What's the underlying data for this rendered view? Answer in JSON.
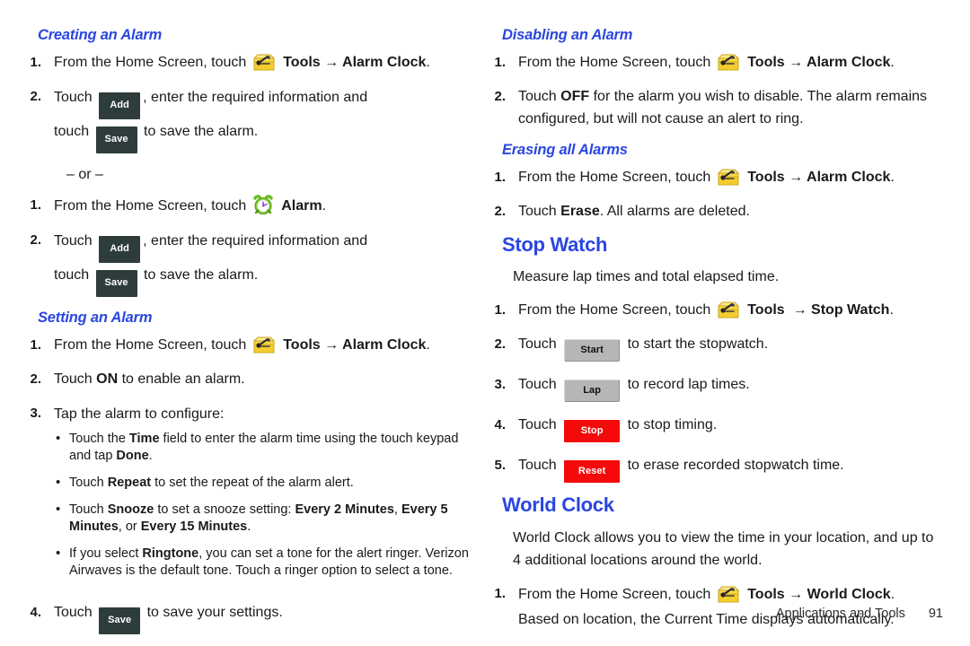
{
  "document": {
    "footer": {
      "section": "Applications and Tools",
      "page_number": "91"
    },
    "colors": {
      "heading_blue": "#2b46e0",
      "dark_button": "#2e3c3c",
      "grey_button": "#b6b6b6",
      "red_button": "#f40a0a",
      "tools_icon_yellow": "#f5d230",
      "alarm_icon_green": "#76cc2a"
    }
  },
  "left_column": {
    "creating_an_alarm": {
      "heading": "Creating an Alarm",
      "step1": {
        "number": "1.",
        "text_before": "From the Home Screen, touch",
        "icon": "tools-icon",
        "bold_target": "Tools",
        "arrow": "→",
        "bold_destination": "Alarm Clock",
        "period": "."
      },
      "step2": {
        "number": "2.",
        "touch_label": "Touch",
        "add_button": "Add",
        "text_after_add": ", enter the required information and",
        "touch_label2": "touch",
        "save_button": "Save",
        "text_after_save": "to save the alarm."
      },
      "or_divider": "– or –",
      "step3": {
        "number": "1.",
        "text_before": "From the Home Screen, touch",
        "icon": "alarm-clock-icon",
        "bold_destination": "Alarm",
        "period": "."
      },
      "step4": {
        "number": "2.",
        "touch_label": "Touch",
        "add_button": "Add",
        "text_after_add": ", enter the required information and",
        "touch_label2": "touch",
        "save_button": "Save",
        "text_after_save": "to save the alarm."
      }
    },
    "setting_an_alarm": {
      "heading": "Setting an Alarm",
      "step1": {
        "number": "1.",
        "text_before": "From the Home Screen, touch",
        "icon": "tools-icon",
        "bold_target": "Tools",
        "arrow": "→",
        "bold_destination": "Alarm Clock",
        "period": "."
      },
      "step2": {
        "number": "2.",
        "text_before": "Touch",
        "bold": "ON",
        "text_after": "to enable an alarm."
      },
      "step3": {
        "number": "3.",
        "text": "Tap the alarm to configure:",
        "bullets": [
          {
            "p1": "Touch the ",
            "b1": "Time",
            "p2": " field to enter the alarm time using the touch keypad and tap ",
            "b2": "Done",
            "p3": "."
          },
          {
            "p1": "Touch ",
            "b1": "Repeat",
            "p2": " to set the repeat of the alarm alert.",
            "b2": "",
            "p3": ""
          },
          {
            "p1": "Touch ",
            "b1": "Snooze",
            "p2": " to set a snooze setting: ",
            "b2": "Every 2 Minutes",
            "p3": ", ",
            "b3": "Every 5 Minutes",
            "p4": ", or ",
            "b4": "Every 15 Minutes",
            "p5": "."
          },
          {
            "p1": "If you select ",
            "b1": "Ringtone",
            "p2": ", you can set a tone for the alert ringer. Verizon Airwaves is the default tone. Touch a ringer option to select a tone.",
            "b2": "",
            "p3": ""
          }
        ]
      },
      "step4": {
        "number": "4.",
        "touch_label": "Touch",
        "save_button": "Save",
        "text_after_save": "to save your settings."
      }
    }
  },
  "right_column": {
    "disabling_an_alarm": {
      "heading": "Disabling an Alarm",
      "step1": {
        "number": "1.",
        "text_before": "From the Home Screen, touch",
        "icon": "tools-icon",
        "bold_target": "Tools",
        "arrow": "→",
        "bold_destination": "Alarm Clock",
        "period": "."
      },
      "step2": {
        "number": "2.",
        "text_before": "Touch",
        "bold": "OFF",
        "text_after": "for the alarm you wish to disable. The alarm remains configured, but will not cause an alert to ring."
      }
    },
    "erasing_all_alarms": {
      "heading": "Erasing all Alarms",
      "step1": {
        "number": "1.",
        "text_before": "From the Home Screen, touch",
        "icon": "tools-icon",
        "bold_target": "Tools",
        "arrow": "→",
        "bold_destination": "Alarm Clock",
        "period": "."
      },
      "step2": {
        "number": "2.",
        "text_before": "Touch",
        "bold": "Erase",
        "text_after": ". All alarms are deleted."
      }
    },
    "stop_watch": {
      "heading": "Stop Watch",
      "intro": "Measure lap times and total elapsed time.",
      "step1": {
        "number": "1.",
        "text_before": "From the Home Screen, touch",
        "icon": "tools-icon",
        "bold_target": "Tools",
        "arrow": "→",
        "bold_destination": "Stop Watch",
        "period": "."
      },
      "step2": {
        "number": "2.",
        "touch_label": "Touch",
        "button": "Start",
        "text_after": "to start the stopwatch."
      },
      "step3": {
        "number": "3.",
        "touch_label": "Touch",
        "button": "Lap",
        "text_after": "to record lap times."
      },
      "step4": {
        "number": "4.",
        "touch_label": "Touch",
        "button": "Stop",
        "text_after": "to stop timing."
      },
      "step5": {
        "number": "5.",
        "touch_label": "Touch",
        "button": "Reset",
        "text_after": "to erase recorded stopwatch time."
      }
    },
    "world_clock": {
      "heading": "World Clock",
      "intro": "World Clock allows you to view the time in your location, and up to 4 additional locations around the world.",
      "step1": {
        "number": "1.",
        "text_before": "From the Home Screen, touch",
        "icon": "tools-icon",
        "bold_target": "Tools",
        "arrow": "→",
        "bold_destination": "World Clock",
        "period": ".",
        "followup": "Based on location, the Current Time displays automatically."
      }
    }
  }
}
